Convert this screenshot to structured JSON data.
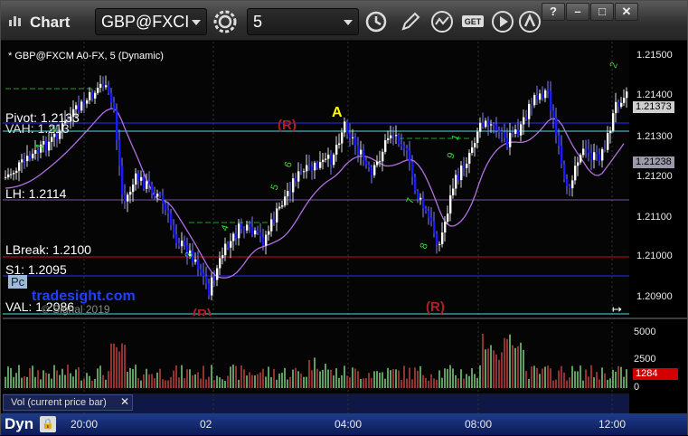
{
  "window": {
    "title": "Chart",
    "symbol": "GBP@FXCI",
    "interval": "5"
  },
  "chart_header": "* GBP@FXCM A0-FX, 5 (Dynamic)",
  "levels": {
    "pivot": "Pivot: 1.2133",
    "vah": "VAH: 1.213",
    "lh": "LH: 1.2114",
    "lbreak": "LBreak: 1.2100",
    "s1": "S1: 1.2095",
    "pc": "Pc",
    "val": "VAL: 1.2086",
    "watermark": "tradesight.com",
    "copyright": "© Signal 2019"
  },
  "markers": {
    "a": "A",
    "r1": "(R)",
    "r2": "(R)",
    "r3": "(R)"
  },
  "price_axis": [
    "1.21500",
    "1.21400",
    "1.21300",
    "1.21200",
    "1.21100",
    "1.21000",
    "1.20900"
  ],
  "price_tags": {
    "last": "1.21373",
    "ma": "1.21238"
  },
  "volume_axis": [
    "5000",
    "2500",
    "0"
  ],
  "volume_tag": "1284",
  "volume_label": "Vol (current price bar)",
  "time_axis": [
    "20:00",
    "02",
    "04:00",
    "08:00",
    "12:00"
  ],
  "footer": "Dyn",
  "colors": {
    "up_candle": "#ffffff",
    "down_candle": "#1a1aff",
    "ma_line": "#b070e0",
    "pivot_line": "#2a2aff",
    "vah_line": "#4fe0e0",
    "lbreak_line": "#d01010"
  },
  "icons": [
    "gear-icon",
    "clock-icon",
    "pencil-icon",
    "indicator-icon",
    "get-icon",
    "play-icon",
    "alert-icon",
    "help-icon",
    "minimize-icon",
    "maximize-icon",
    "close-icon",
    "lock-icon"
  ]
}
